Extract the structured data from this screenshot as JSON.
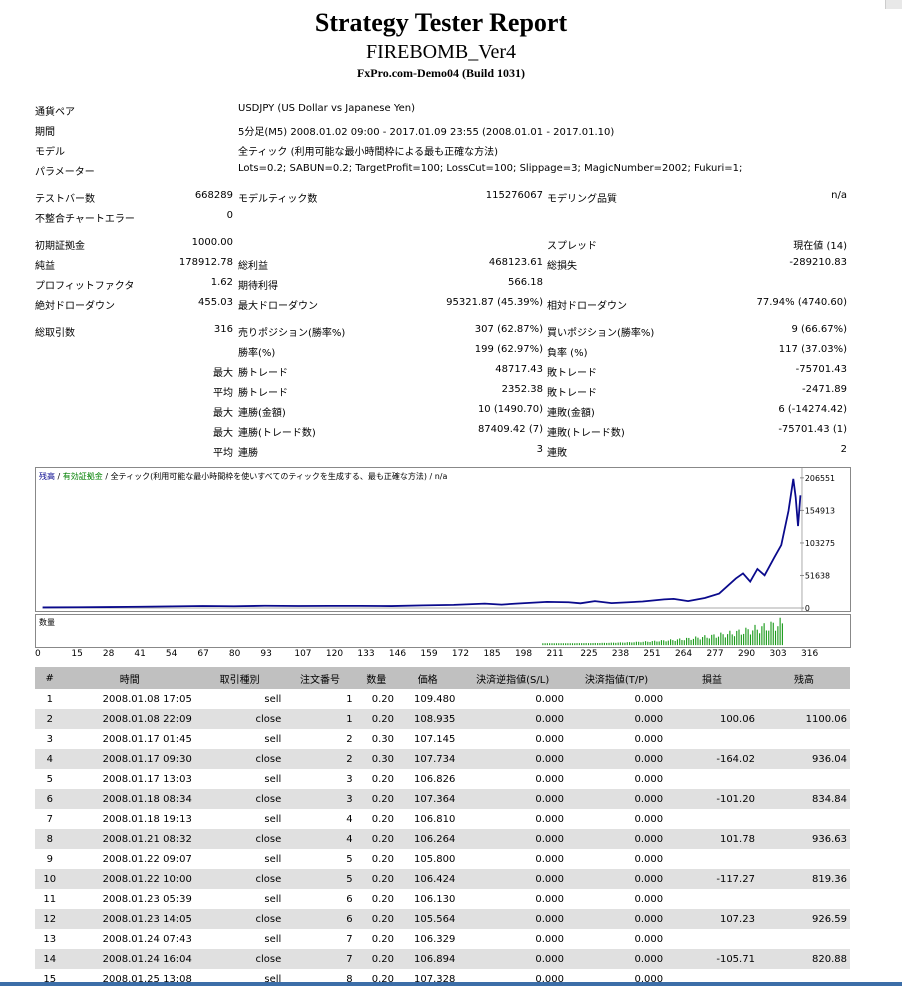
{
  "header": {
    "title": "Strategy Tester Report",
    "ea_name": "FIREBOMB_Ver4",
    "broker": "FxPro.com-Demo04 (Build 1031)"
  },
  "summary": {
    "symbol_label": "通貨ペア",
    "symbol_value": "USDJPY (US Dollar vs Japanese Yen)",
    "period_label": "期間",
    "period_value": "5分足(M5) 2008.01.02 09:00 - 2017.01.09 23:55 (2008.01.01 - 2017.01.10)",
    "model_label": "モデル",
    "model_value": "全ティック (利用可能な最小時間枠による最も正確な方法)",
    "params_label": "パラメーター",
    "params_value": "Lots=0.2; SABUN=0.2; TargetProfit=100; LossCut=100; Slippage=3; MagicNumber=2002; Fukuri=1;",
    "bars_label": "テストバー数",
    "bars_value": "668289",
    "ticks_label": "モデルティック数",
    "ticks_value": "115276067",
    "quality_label": "モデリング品質",
    "quality_value": "n/a",
    "mismatch_label": "不整合チャートエラー",
    "mismatch_value": "0",
    "deposit_label": "初期証拠金",
    "deposit_value": "1000.00",
    "spread_label": "スプレッド",
    "spread_value": "現在値 (14)",
    "netprofit_label": "純益",
    "netprofit_value": "178912.78",
    "grossprofit_label": "総利益",
    "grossprofit_value": "468123.61",
    "grossloss_label": "総損失",
    "grossloss_value": "-289210.83",
    "pf_label": "プロフィットファクタ",
    "pf_value": "1.62",
    "expected_label": "期待利得",
    "expected_value": "566.18",
    "absdd_label": "絶対ドローダウン",
    "absdd_value": "455.03",
    "maxdd_label": "最大ドローダウン",
    "maxdd_value": "95321.87 (45.39%)",
    "reldd_label": "相対ドローダウン",
    "reldd_value": "77.94% (4740.60)",
    "trades_label": "総取引数",
    "trades_value": "316",
    "short_label": "売りポジション(勝率%)",
    "short_value": "307 (62.87%)",
    "long_label": "買いポジション(勝率%)",
    "long_value": "9 (66.67%)",
    "winrate_label": "勝率(%)",
    "winrate_value": "199 (62.97%)",
    "lossrate_label": "負率 (%)",
    "lossrate_value": "117 (37.03%)",
    "max_label": "最大",
    "avg_label": "平均",
    "win_trade_label": "勝トレード",
    "loss_trade_label": "敗トレード",
    "largest_win": "48717.43",
    "largest_loss": "-75701.43",
    "average_win": "2352.38",
    "average_loss": "-2471.89",
    "consec_win_amt_label": "連勝(金額)",
    "consec_win_amt": "10 (1490.70)",
    "consec_loss_amt_label": "連敗(金額)",
    "consec_loss_amt": "6 (-14274.42)",
    "consec_win_cnt_label": "連勝(トレード数)",
    "consec_win_cnt": "87409.42 (7)",
    "consec_loss_cnt_label": "連敗(トレード数)",
    "consec_loss_cnt": "-75701.43 (1)",
    "avg_consec_win_label": "連勝",
    "avg_consec_win": "3",
    "avg_consec_loss_label": "連敗",
    "avg_consec_loss": "2"
  },
  "chart": {
    "balance_label": "残高",
    "sep1": " / ",
    "equity_label": "有効証拠金",
    "rest": " / 全ティック(利用可能な最小時間枠を使いすべてのティックを生成する、最も正確な方法) / n/a",
    "volume_label": "数量"
  },
  "chart_data": {
    "type": "line",
    "y_ticks": [
      "206551",
      "154913",
      "103275",
      "51638",
      "0"
    ],
    "x_ticks": [
      "0",
      "15",
      "28",
      "41",
      "54",
      "67",
      "80",
      "93",
      "107",
      "120",
      "133",
      "146",
      "159",
      "172",
      "185",
      "198",
      "211",
      "225",
      "238",
      "251",
      "264",
      "277",
      "290",
      "303",
      "316"
    ],
    "ylim": [
      0,
      206551
    ],
    "xlim": [
      0,
      316
    ],
    "series": [
      {
        "values": [
          [
            0,
            1000
          ],
          [
            15,
            1300
          ],
          [
            28,
            1600
          ],
          [
            41,
            2100
          ],
          [
            54,
            2600
          ],
          [
            67,
            3300
          ],
          [
            80,
            2800
          ],
          [
            93,
            3600
          ],
          [
            107,
            3300
          ],
          [
            120,
            3400
          ],
          [
            133,
            3500
          ],
          [
            146,
            3200
          ],
          [
            159,
            4300
          ],
          [
            172,
            5000
          ],
          [
            185,
            7100
          ],
          [
            192,
            5400
          ],
          [
            198,
            7000
          ],
          [
            211,
            9900
          ],
          [
            220,
            9200
          ],
          [
            225,
            7500
          ],
          [
            231,
            11000
          ],
          [
            238,
            7900
          ],
          [
            251,
            10400
          ],
          [
            260,
            13800
          ],
          [
            264,
            14600
          ],
          [
            270,
            11000
          ],
          [
            277,
            16000
          ],
          [
            283,
            23000
          ],
          [
            290,
            47000
          ],
          [
            293,
            55000
          ],
          [
            296,
            42000
          ],
          [
            299,
            62000
          ],
          [
            302,
            52000
          ],
          [
            306,
            80000
          ],
          [
            309,
            100000
          ],
          [
            312,
            154000
          ],
          [
            314,
            205000
          ],
          [
            315,
            176000
          ],
          [
            316,
            130000
          ],
          [
            317,
            178913
          ]
        ]
      }
    ],
    "volume_bars_from_trade": 211
  },
  "table": {
    "headers": [
      "#",
      "時間",
      "取引種別",
      "注文番号",
      "数量",
      "価格",
      "決済逆指値(S/L)",
      "決済指値(T/P)",
      "損益",
      "残高"
    ],
    "rows": [
      [
        "1",
        "2008.01.08 17:05",
        "sell",
        "1",
        "0.20",
        "109.480",
        "0.000",
        "0.000",
        "",
        ""
      ],
      [
        "2",
        "2008.01.08 22:09",
        "close",
        "1",
        "0.20",
        "108.935",
        "0.000",
        "0.000",
        "100.06",
        "1100.06"
      ],
      [
        "3",
        "2008.01.17 01:45",
        "sell",
        "2",
        "0.30",
        "107.145",
        "0.000",
        "0.000",
        "",
        ""
      ],
      [
        "4",
        "2008.01.17 09:30",
        "close",
        "2",
        "0.30",
        "107.734",
        "0.000",
        "0.000",
        "-164.02",
        "936.04"
      ],
      [
        "5",
        "2008.01.17 13:03",
        "sell",
        "3",
        "0.20",
        "106.826",
        "0.000",
        "0.000",
        "",
        ""
      ],
      [
        "6",
        "2008.01.18 08:34",
        "close",
        "3",
        "0.20",
        "107.364",
        "0.000",
        "0.000",
        "-101.20",
        "834.84"
      ],
      [
        "7",
        "2008.01.18 19:13",
        "sell",
        "4",
        "0.20",
        "106.810",
        "0.000",
        "0.000",
        "",
        ""
      ],
      [
        "8",
        "2008.01.21 08:32",
        "close",
        "4",
        "0.20",
        "106.264",
        "0.000",
        "0.000",
        "101.78",
        "936.63"
      ],
      [
        "9",
        "2008.01.22 09:07",
        "sell",
        "5",
        "0.20",
        "105.800",
        "0.000",
        "0.000",
        "",
        ""
      ],
      [
        "10",
        "2008.01.22 10:00",
        "close",
        "5",
        "0.20",
        "106.424",
        "0.000",
        "0.000",
        "-117.27",
        "819.36"
      ],
      [
        "11",
        "2008.01.23 05:39",
        "sell",
        "6",
        "0.20",
        "106.130",
        "0.000",
        "0.000",
        "",
        ""
      ],
      [
        "12",
        "2008.01.23 14:05",
        "close",
        "6",
        "0.20",
        "105.564",
        "0.000",
        "0.000",
        "107.23",
        "926.59"
      ],
      [
        "13",
        "2008.01.24 07:43",
        "sell",
        "7",
        "0.20",
        "106.329",
        "0.000",
        "0.000",
        "",
        ""
      ],
      [
        "14",
        "2008.01.24 16:04",
        "close",
        "7",
        "0.20",
        "106.894",
        "0.000",
        "0.000",
        "-105.71",
        "820.88"
      ],
      [
        "15",
        "2008.01.25 13:08",
        "sell",
        "8",
        "0.20",
        "107.328",
        "0.000",
        "0.000",
        "",
        ""
      ]
    ]
  }
}
